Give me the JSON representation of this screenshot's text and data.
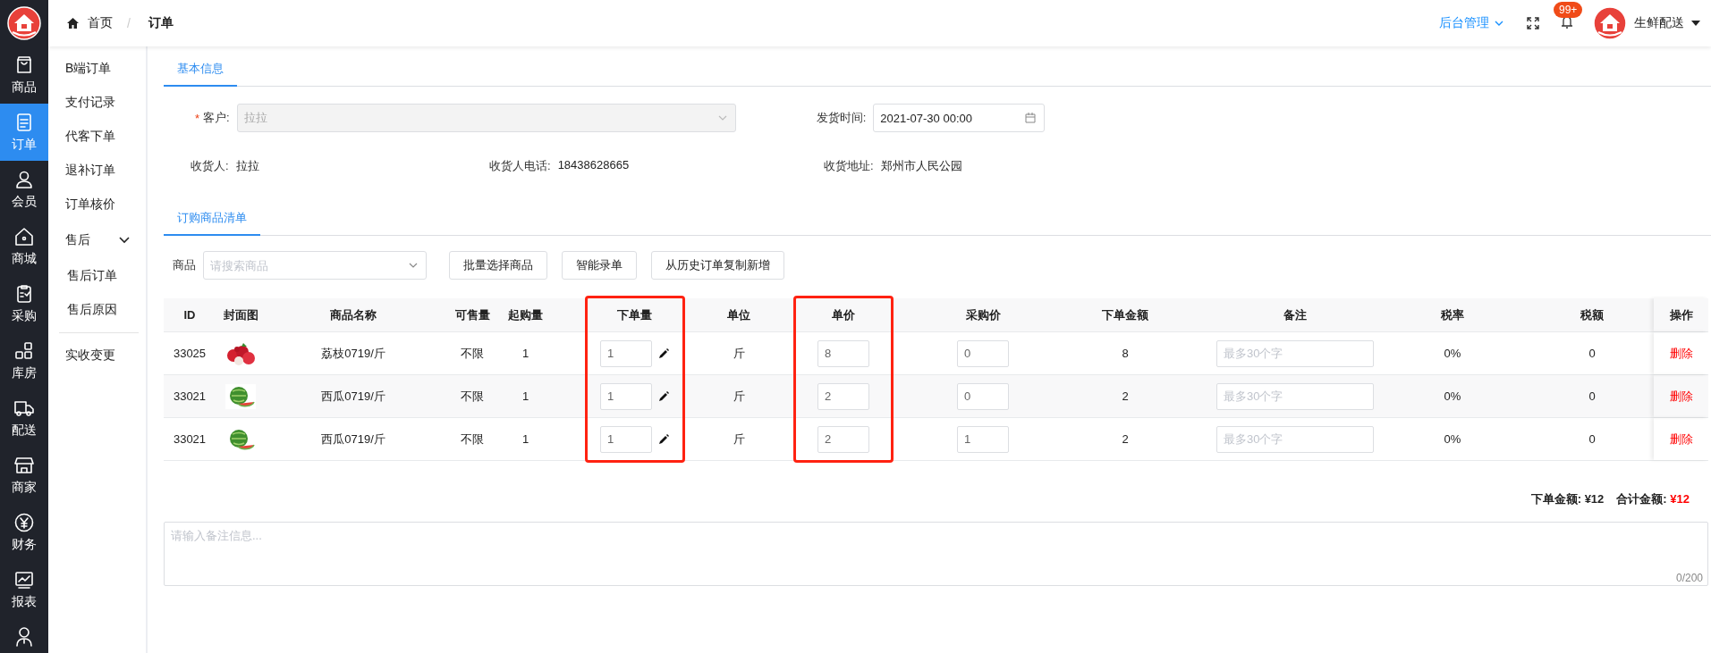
{
  "nav": {
    "items": [
      {
        "label": "商品",
        "selected": false
      },
      {
        "label": "订单",
        "selected": true
      },
      {
        "label": "会员",
        "selected": false
      },
      {
        "label": "商城",
        "selected": false
      },
      {
        "label": "采购",
        "selected": false
      },
      {
        "label": "库房",
        "selected": false
      },
      {
        "label": "配送",
        "selected": false
      },
      {
        "label": "商家",
        "selected": false
      },
      {
        "label": "财务",
        "selected": false
      },
      {
        "label": "报表",
        "selected": false
      }
    ]
  },
  "submenu": {
    "items": [
      {
        "label": "B端订单"
      },
      {
        "label": "支付记录"
      },
      {
        "label": "代客下单"
      },
      {
        "label": "退补订单"
      },
      {
        "label": "订单核价"
      },
      {
        "label": "售后",
        "expanded": true,
        "children": [
          {
            "label": "售后订单"
          },
          {
            "label": "售后原因"
          }
        ]
      },
      {
        "label": "实收变更"
      }
    ]
  },
  "breadcrumb": {
    "items": [
      "首页",
      "订单"
    ],
    "separator": "/"
  },
  "header": {
    "admin_menu": "后台管理",
    "badge": "99+",
    "user": "生鲜配送"
  },
  "basic_tab": "基本信息",
  "form": {
    "customer": {
      "required_mark": "*",
      "label": "客户:",
      "value": "拉拉",
      "disabled": true
    },
    "ship_time": {
      "label": "发货时间:",
      "value": "2021-07-30 00:00"
    },
    "receiver": {
      "label": "收货人:",
      "value": "拉拉"
    },
    "phone": {
      "label": "收货人电话:",
      "value": "18438628665"
    },
    "address": {
      "label": "收货地址:",
      "value": "郑州市人民公园"
    }
  },
  "goods_tab": "订购商品清单",
  "toolbar": {
    "label": "商品",
    "search": {
      "placeholder": "请搜索商品"
    },
    "buttons": [
      "批量选择商品",
      "智能录单",
      "从历史订单复制新增"
    ]
  },
  "table": {
    "columns": [
      {
        "label": "ID",
        "highlighted": false
      },
      {
        "label": "封面图",
        "highlighted": false
      },
      {
        "label": "商品名称",
        "highlighted": false
      },
      {
        "label": "可售量",
        "highlighted": false
      },
      {
        "label": "起购量",
        "highlighted": false
      },
      {
        "label": "下单量",
        "highlighted": true
      },
      {
        "label": "单位",
        "highlighted": false
      },
      {
        "label": "单价",
        "highlighted": true
      },
      {
        "label": "采购价",
        "highlighted": false
      },
      {
        "label": "下单金额",
        "highlighted": false
      },
      {
        "label": "备注",
        "highlighted": false
      },
      {
        "label": "税率",
        "highlighted": false
      },
      {
        "label": "税额",
        "highlighted": false
      },
      {
        "label": "操作",
        "highlighted": false
      }
    ],
    "rows": [
      {
        "id": "33025",
        "name": "荔枝0719/斤",
        "stock": "不限",
        "min_qty": "1",
        "qty": "1",
        "unit": "斤",
        "price": "8",
        "cost": "0",
        "amount": "8",
        "note": {
          "placeholder": "最多30个字"
        },
        "tax_rate": "0%",
        "tax": "0",
        "action": "删除"
      },
      {
        "id": "33021",
        "name": "西瓜0719/斤",
        "stock": "不限",
        "min_qty": "1",
        "qty": "1",
        "unit": "斤",
        "price": "2",
        "cost": "0",
        "amount": "2",
        "note": {
          "placeholder": "最多30个字"
        },
        "tax_rate": "0%",
        "tax": "0",
        "action": "删除"
      },
      {
        "id": "33021",
        "name": "西瓜0719/斤",
        "stock": "不限",
        "min_qty": "1",
        "qty": "1",
        "unit": "斤",
        "price": "2",
        "cost": "1",
        "amount": "2",
        "note": {
          "placeholder": "最多30个字"
        },
        "tax_rate": "0%",
        "tax": "0",
        "action": "删除"
      }
    ]
  },
  "summary": {
    "order_label": "下单金额:",
    "order_value": "¥12",
    "total_label": "合计金额:",
    "total_value": "¥12"
  },
  "remark": {
    "placeholder": "请输入备注信息...",
    "counter": "0/200"
  }
}
